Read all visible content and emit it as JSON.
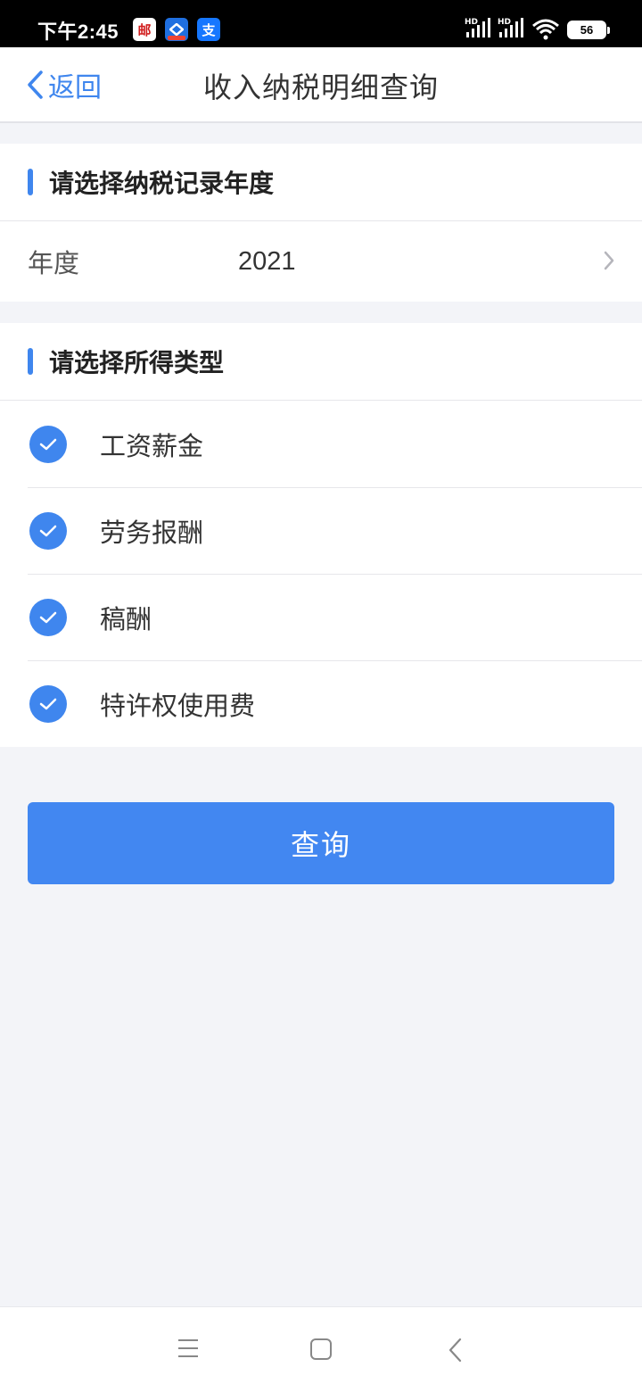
{
  "status_bar": {
    "time": "下午2:45",
    "battery": "56",
    "hd1": "HD",
    "hd2": "HD",
    "apps": [
      {
        "name": "mail-app-icon",
        "glyph": "邮"
      },
      {
        "name": "tax-app-icon",
        "glyph": ""
      },
      {
        "name": "alipay-app-icon",
        "glyph": "支"
      }
    ]
  },
  "nav": {
    "back_label": "返回",
    "title": "收入纳税明细查询"
  },
  "year_section": {
    "title": "请选择纳税记录年度",
    "row_label": "年度",
    "row_value": "2021"
  },
  "income_section": {
    "title": "请选择所得类型",
    "options": [
      {
        "label": "工资薪金",
        "checked": true
      },
      {
        "label": "劳务报酬",
        "checked": true
      },
      {
        "label": "稿酬",
        "checked": true
      },
      {
        "label": "特许权使用费",
        "checked": true
      }
    ]
  },
  "query_button": "查询",
  "colors": {
    "accent": "#3f86ee",
    "button": "#4287f1",
    "background": "#f3f4f8"
  }
}
